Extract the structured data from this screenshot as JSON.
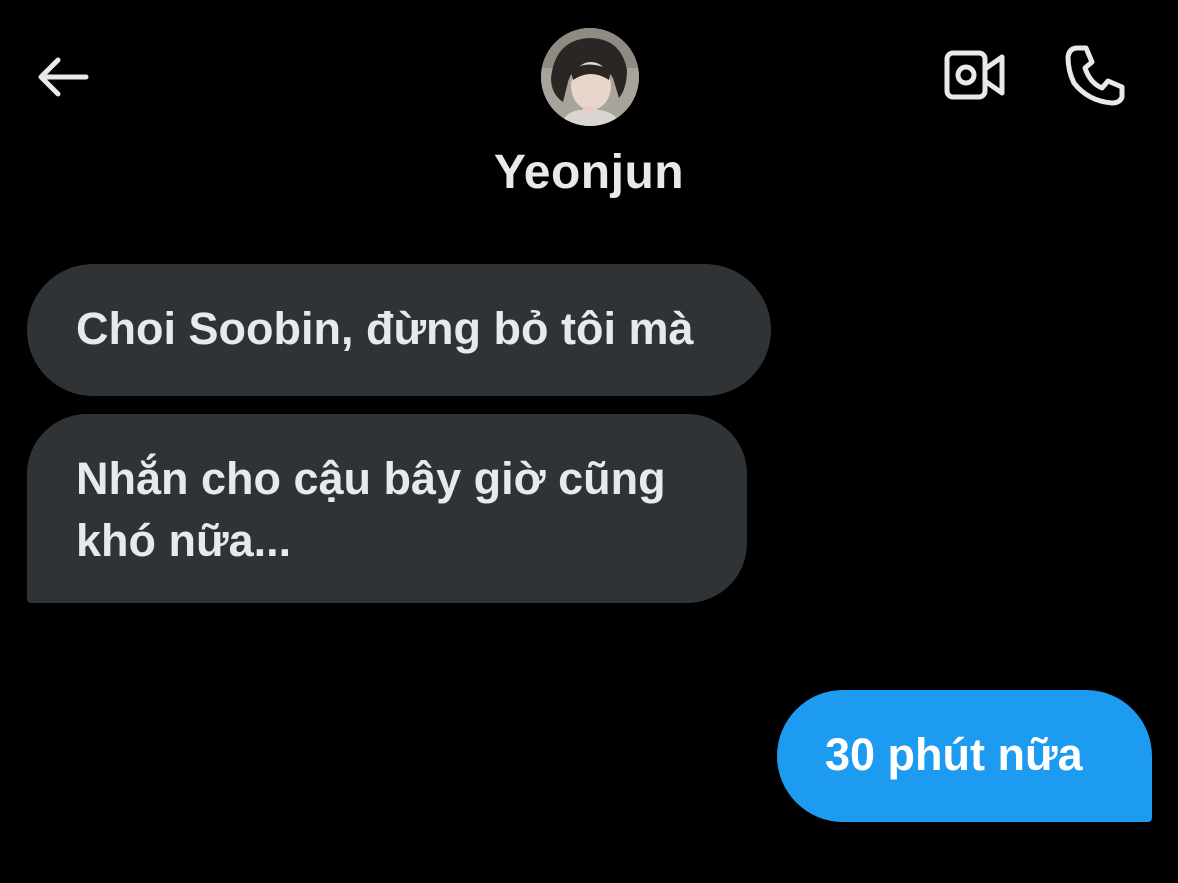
{
  "header": {
    "contact_name": "Yeonjun",
    "back_icon": "arrow-left-icon",
    "video_icon": "video-camera-icon",
    "call_icon": "phone-icon"
  },
  "messages": [
    {
      "direction": "received",
      "text": "Choi Soobin, đừng bỏ tôi mà"
    },
    {
      "direction": "received",
      "text": "Nhắn cho cậu bây giờ cũng khó nữa..."
    },
    {
      "direction": "sent",
      "text": "30 phút nữa"
    }
  ],
  "colors": {
    "background": "#000000",
    "received_bubble": "#2f3336",
    "sent_bubble": "#1d9bf0",
    "text": "#e7e9ea"
  }
}
